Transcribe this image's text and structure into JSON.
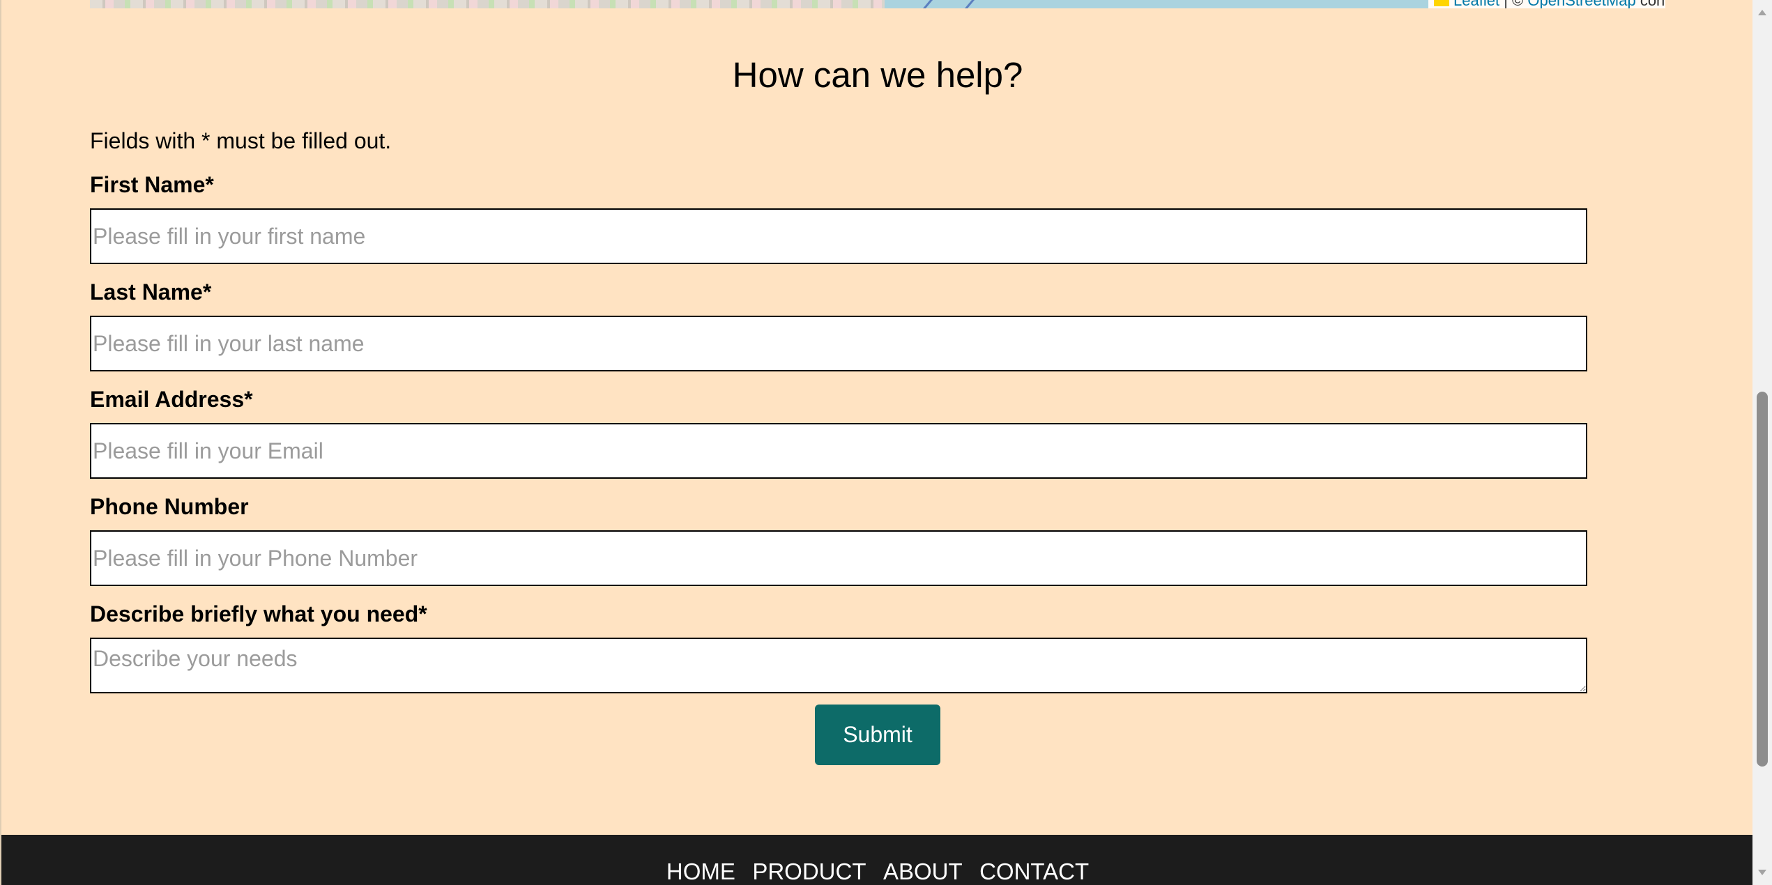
{
  "map": {
    "attribution_leaflet": "Leaflet",
    "attribution_separator": "|",
    "attribution_copyright": "©",
    "attribution_osm": "OpenStreetMap",
    "attribution_suffix": "contributors"
  },
  "form": {
    "heading": "How can we help?",
    "note": "Fields with * must be filled out.",
    "first_name": {
      "label": "First Name*",
      "placeholder": "Please fill in your first name"
    },
    "last_name": {
      "label": "Last Name*",
      "placeholder": "Please fill in your last name"
    },
    "email": {
      "label": "Email Address*",
      "placeholder": "Please fill in your Email"
    },
    "phone": {
      "label": "Phone Number",
      "placeholder": "Please fill in your Phone Number"
    },
    "needs": {
      "label": "Describe briefly what you need*",
      "placeholder": "Describe your needs"
    },
    "submit_label": "Submit"
  },
  "footer": {
    "nav": [
      "HOME",
      "PRODUCT",
      "ABOUT",
      "CONTACT"
    ]
  },
  "colors": {
    "page_bg": "#ffe3c2",
    "button_bg": "#0d6b68",
    "footer_bg": "#1c1c1c"
  }
}
